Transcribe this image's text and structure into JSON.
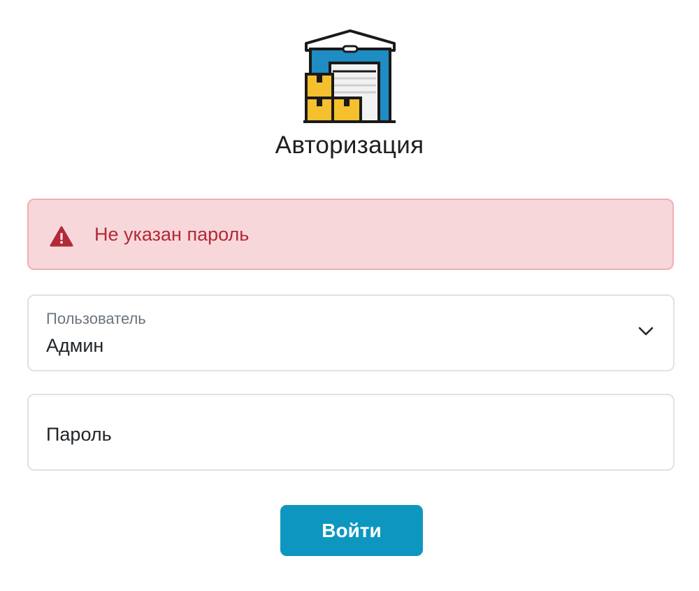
{
  "logo": {
    "icon": "warehouse-icon"
  },
  "title": "Авторизация",
  "alert": {
    "icon": "warning-triangle-icon",
    "message": "Не указан пароль",
    "color_bg": "#f8d7da",
    "color_text": "#b02a37"
  },
  "user_field": {
    "label": "Пользователь",
    "selected": "Админ",
    "icon": "chevron-down-icon"
  },
  "password_field": {
    "placeholder": "Пароль",
    "value": ""
  },
  "login_button": {
    "label": "Войти",
    "color": "#0d97c0"
  }
}
